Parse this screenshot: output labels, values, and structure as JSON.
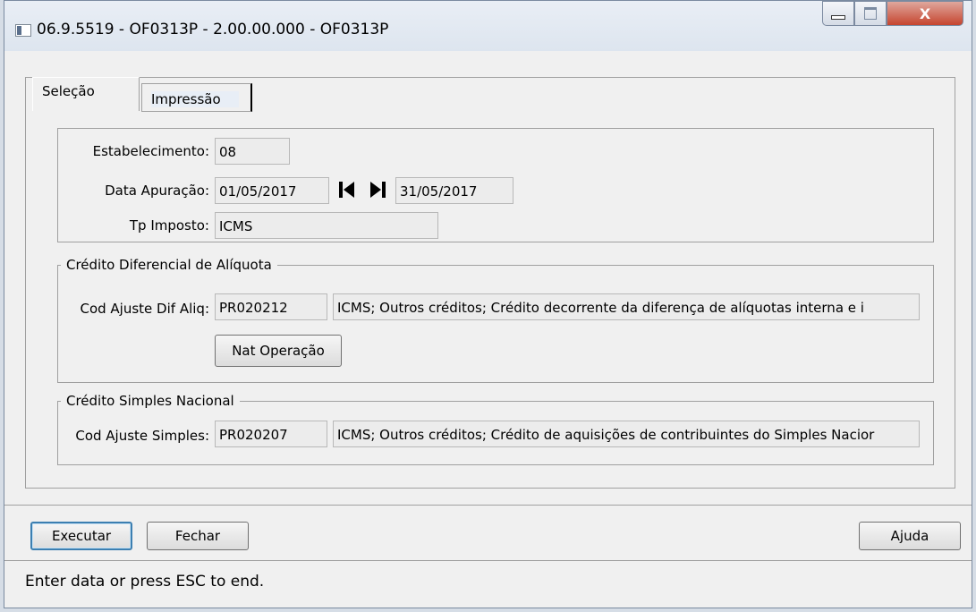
{
  "window": {
    "title": "06.9.5519 - OF0313P - 2.00.00.000 - OF0313P",
    "close_glyph": "X"
  },
  "tabs": [
    {
      "label": "Seleção",
      "active": true
    },
    {
      "label": "Impressão",
      "active": false
    }
  ],
  "selection": {
    "estabelecimento_label": "Estabelecimento:",
    "estabelecimento_value": "08",
    "data_apuracao_label": "Data Apuração:",
    "data_inicio": "01/05/2017",
    "data_fim": "31/05/2017",
    "tp_imposto_label": "Tp Imposto:",
    "tp_imposto_value": "ICMS"
  },
  "dif_aliquota": {
    "title": "Crédito Diferencial de Alíquota",
    "cod_label": "Cod Ajuste Dif Aliq:",
    "cod_value": "PR020212",
    "cod_description": "ICMS; Outros créditos; Crédito decorrente da diferença de alíquotas interna e i",
    "nat_operacao_label": "Nat Operação"
  },
  "simples": {
    "title": "Crédito Simples Nacional",
    "cod_label": "Cod Ajuste Simples:",
    "cod_value": "PR020207",
    "cod_description": "ICMS; Outros créditos; Crédito de aquisições de contribuintes do Simples Nacior"
  },
  "buttons": {
    "executar": "Executar",
    "fechar": "Fechar",
    "ajuda": "Ajuda"
  },
  "status_text": "Enter data or press ESC to end."
}
